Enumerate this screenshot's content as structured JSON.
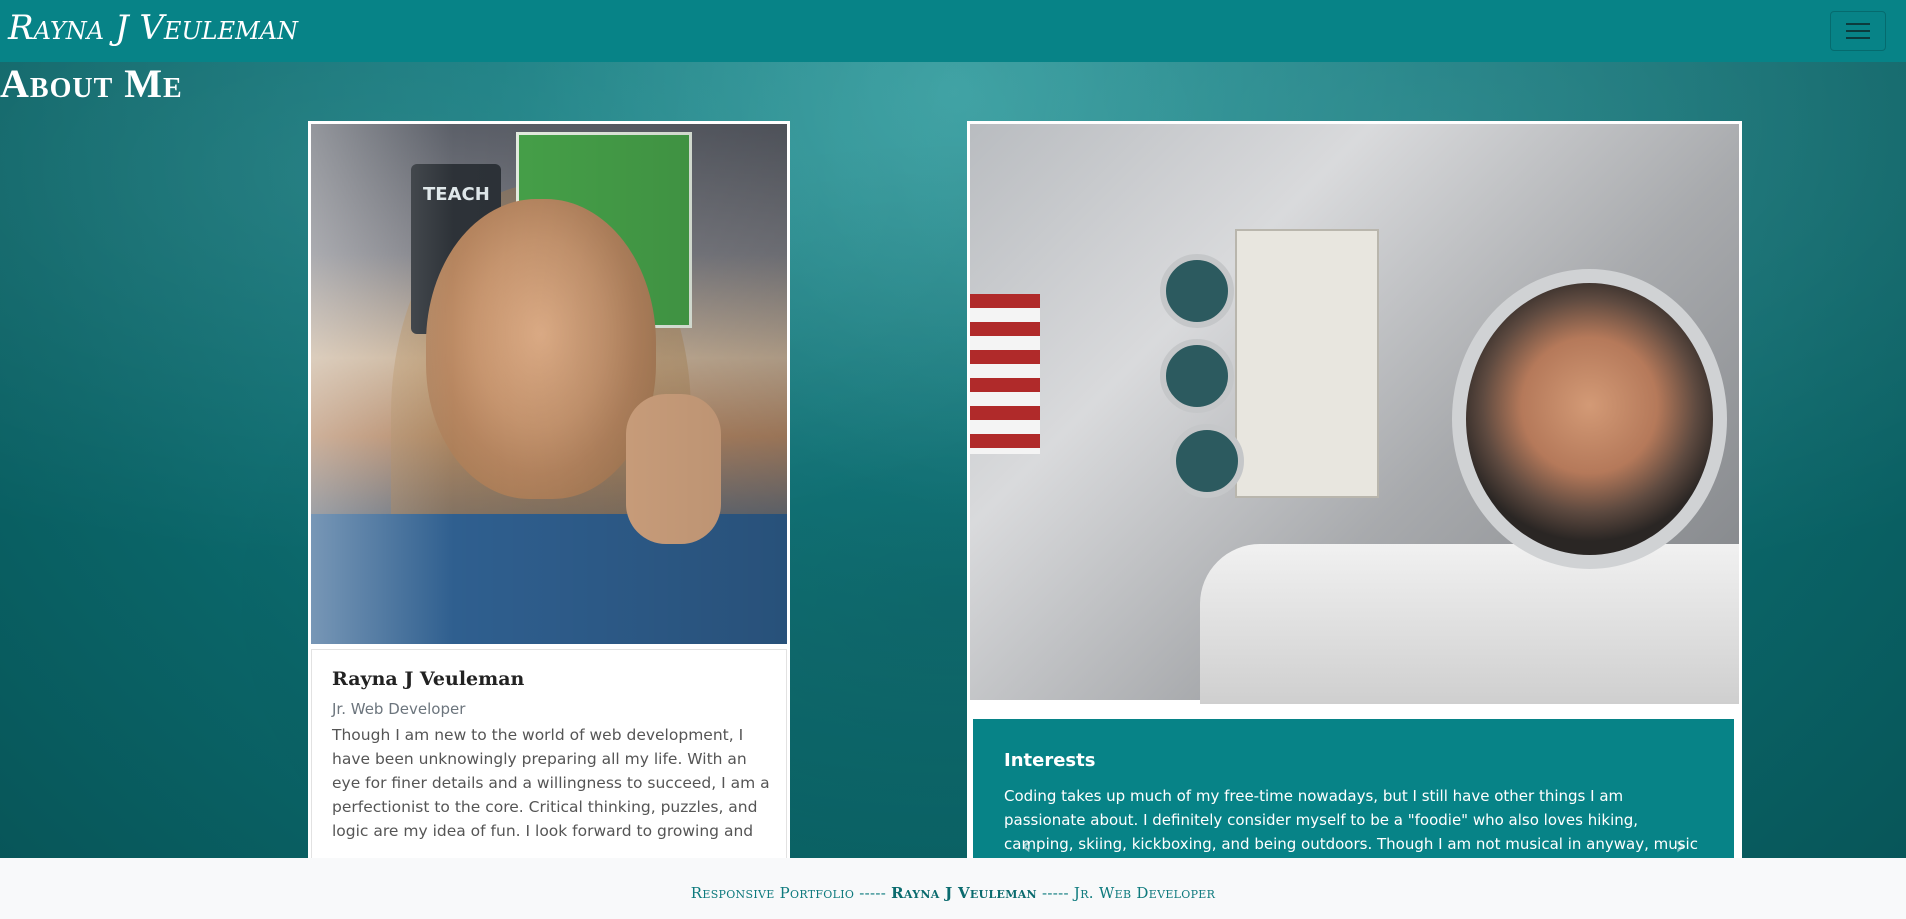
{
  "navbar": {
    "brand": "Rayna J Veuleman",
    "menu_icon": "hamburger-menu-icon"
  },
  "page": {
    "title": "About Me"
  },
  "profile_card": {
    "name": "Rayna J Veuleman",
    "role": "Jr. Web Developer",
    "bio": "Though I am new to the world of web development, I have been unknowingly preparing all my life. With an eye for finer details and a willingness to succeed, I am a perfectionist to the core. Critical thinking, puzzles, and logic are my idea of fun. I look forward to growing and"
  },
  "interests_carousel": {
    "title": "Interests",
    "text": "Coding takes up much of my free-time nowadays, but I still have other things I am passionate about. I definitely consider myself to be a \"foodie\" who also loves hiking, camping, skiing, kickboxing, and being outdoors. Though I am not musical in anyway, music is life. Some of my",
    "prev_icon": "chevron-left-icon",
    "next_icon": "chevron-right-icon"
  },
  "footer": {
    "left": "Responsive Portfolio -----",
    "name": "Rayna J Veuleman",
    "right": "----- Jr. Web Developer"
  },
  "colors": {
    "navbar": "#078387",
    "caption_bg": "#078387",
    "footer_bg": "#f8f9fa",
    "footer_text": "#0d7a7d"
  }
}
